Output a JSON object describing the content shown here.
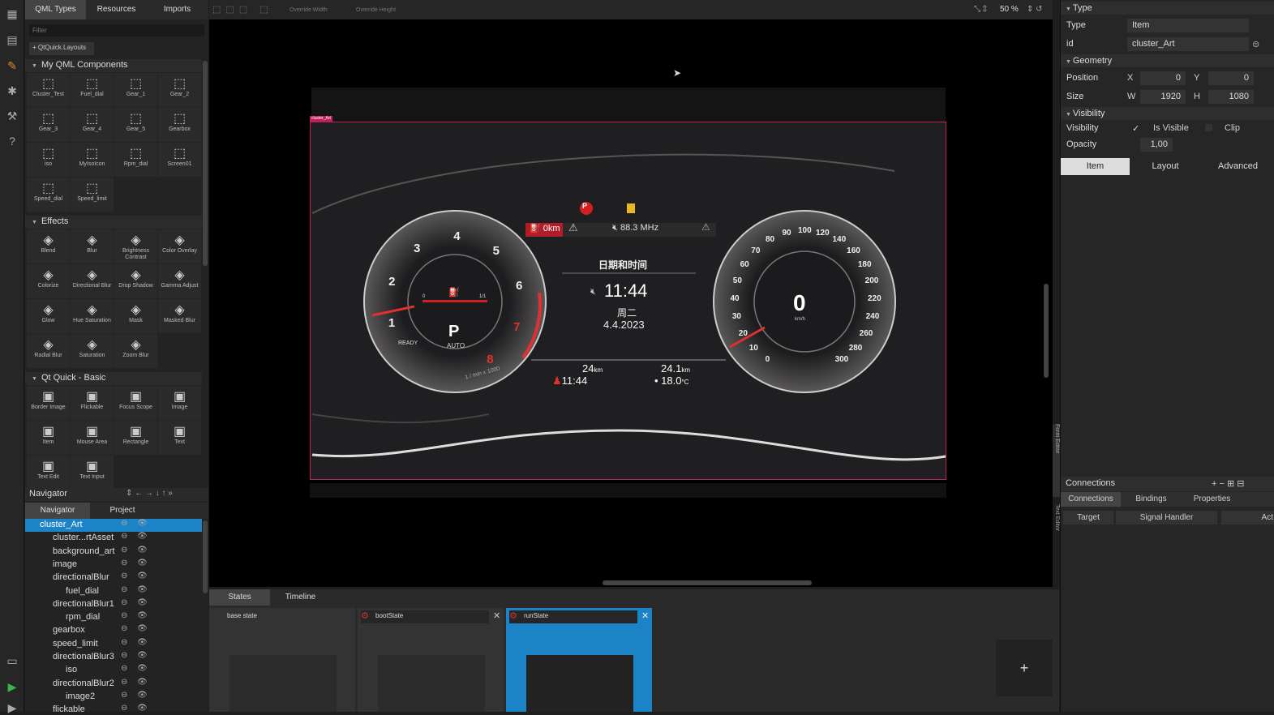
{
  "library": {
    "tabs": [
      "QML Types",
      "Resources",
      "Imports"
    ],
    "filter_placeholder": "Filter",
    "add_module": "QtQuick.Layouts",
    "sections": [
      {
        "title": "My QML Components",
        "items": [
          "Cluster_Test",
          "Fuel_dial",
          "Gear_1",
          "Gear_2",
          "Gear_3",
          "Gear_4",
          "Gear_5",
          "Gearbox",
          "iso",
          "MyIsoIcon",
          "Rpm_dial",
          "Screen01",
          "Speed_dial",
          "Speed_limit"
        ]
      },
      {
        "title": "Effects",
        "items": [
          "Blend",
          "Blur",
          "Brightness Contrast",
          "Color Overlay",
          "Colorize",
          "Directional Blur",
          "Drop Shadow",
          "Gamma Adjust",
          "Glow",
          "Hue Saturation",
          "Mask",
          "Masked Blur",
          "Radial Blur",
          "Saturation",
          "Zoom Blur"
        ]
      },
      {
        "title": "Qt Quick - Basic",
        "items": [
          "Border Image",
          "Flickable",
          "Focus Scope",
          "Image",
          "Item",
          "Mouse Area",
          "Rectangle",
          "Text",
          "Text Edit",
          "Text Input"
        ]
      }
    ]
  },
  "navigator": {
    "title": "Navigator",
    "tabs": [
      "Navigator",
      "Project"
    ],
    "tree": [
      {
        "label": "cluster_Art",
        "indent": 0,
        "selected": true
      },
      {
        "label": "cluster...rtAsset",
        "indent": 1
      },
      {
        "label": "background_art",
        "indent": 1
      },
      {
        "label": "image",
        "indent": 1
      },
      {
        "label": "directionalBlur",
        "indent": 1
      },
      {
        "label": "fuel_dial",
        "indent": 2
      },
      {
        "label": "directionalBlur1",
        "indent": 1
      },
      {
        "label": "rpm_dial",
        "indent": 2
      },
      {
        "label": "gearbox",
        "indent": 1
      },
      {
        "label": "speed_limit",
        "indent": 1
      },
      {
        "label": "directionalBlur3",
        "indent": 1
      },
      {
        "label": "iso",
        "indent": 2
      },
      {
        "label": "directionalBlur2",
        "indent": 1
      },
      {
        "label": "image2",
        "indent": 2
      },
      {
        "label": "flickable",
        "indent": 1
      }
    ]
  },
  "canvas_toolbar": {
    "override_width": "Override Width",
    "override_height": "Override Height",
    "zoom": "50 %"
  },
  "cluster": {
    "tag": "cluster_Art",
    "odo_left": "0km",
    "radio": "88.3 MHz",
    "date_title": "日期和时间",
    "time": "11:44",
    "weekday": "周二",
    "date": "4.4.2023",
    "gear": "P",
    "gear_mode": "AUTO",
    "ready": "READY",
    "rpm_unit": "1 / min x 1000",
    "speed": "0",
    "speed_unit": "km/h",
    "trip1": "24",
    "trip1_unit": "km",
    "trip2": "24.1",
    "trip2_unit": "km",
    "drive_time": "11:44",
    "temp": "18.0",
    "temp_unit": "°C",
    "rpm_ticks": [
      "1",
      "2",
      "3",
      "4",
      "5",
      "6",
      "7",
      "8"
    ],
    "speed_ticks": [
      "0",
      "10",
      "20",
      "30",
      "40",
      "50",
      "60",
      "70",
      "80",
      "90",
      "100",
      "120",
      "140",
      "160",
      "180",
      "200",
      "220",
      "240",
      "260",
      "280",
      "300"
    ],
    "fuel_min": "0",
    "fuel_max": "1/1"
  },
  "states": {
    "tabs": [
      "States",
      "Timeline"
    ],
    "items": [
      "base state",
      "bootState",
      "runState"
    ],
    "add": "+"
  },
  "properties": {
    "type_header": "Type",
    "type_label": "Type",
    "type_value": "Item",
    "id_label": "id",
    "id_value": "cluster_Art",
    "geometry_header": "Geometry",
    "position_label": "Position",
    "x_label": "X",
    "x_value": "0",
    "y_label": "Y",
    "y_value": "0",
    "size_label": "Size",
    "w_label": "W",
    "w_value": "1920",
    "h_label": "H",
    "h_value": "1080",
    "visibility_header": "Visibility",
    "visibility_label": "Visibility",
    "is_visible": "Is Visible",
    "clip": "Clip",
    "opacity_label": "Opacity",
    "opacity_value": "1,00",
    "tabs": [
      "Item",
      "Layout",
      "Advanced"
    ],
    "connections_title": "Connections",
    "conn_tabs": [
      "Connections",
      "Bindings",
      "Properties"
    ],
    "conn_cols": [
      "Target",
      "Signal Handler",
      "Act"
    ],
    "side_labels": [
      "Form Editor",
      "Text Editor"
    ]
  }
}
